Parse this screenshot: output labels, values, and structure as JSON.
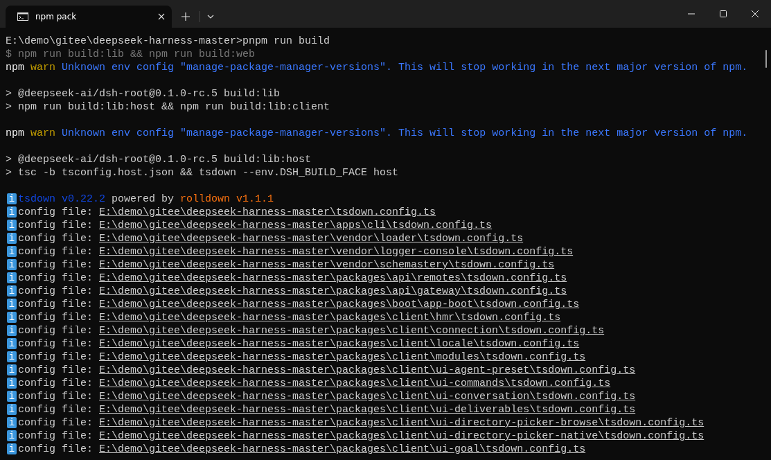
{
  "window": {
    "tab": {
      "title": "npm pack",
      "selected": true
    }
  },
  "lines": [
    {
      "kind": "text",
      "segments": [
        {
          "text": "E:\\demo\\gitee\\deepseek-harness-master>pnpm run build",
          "kind": "plain"
        }
      ]
    },
    {
      "kind": "text",
      "segments": [
        {
          "text": "$ npm run build:lib && npm run build:web",
          "kind": "dim"
        }
      ]
    },
    {
      "kind": "text",
      "segments": [
        {
          "text": "npm",
          "kind": "bright"
        },
        {
          "text": " warn",
          "kind": "warn"
        },
        {
          "text": " Unknown env config \"manage-package-manager-versions\". This will stop working in the next major version of npm.",
          "kind": "blue"
        }
      ]
    },
    {
      "kind": "blank"
    },
    {
      "kind": "text",
      "segments": [
        {
          "text": "> @deepseek-ai/dsh-root@0.1.0-rc.5 build:lib",
          "kind": "plain"
        }
      ]
    },
    {
      "kind": "text",
      "segments": [
        {
          "text": "> npm run build:lib:host && npm run build:lib:client",
          "kind": "plain"
        }
      ]
    },
    {
      "kind": "blank"
    },
    {
      "kind": "text",
      "segments": [
        {
          "text": "npm",
          "kind": "bright"
        },
        {
          "text": " warn",
          "kind": "warn"
        },
        {
          "text": " Unknown env config \"manage-package-manager-versions\". This will stop working in the next major version of npm.",
          "kind": "blue"
        }
      ]
    },
    {
      "kind": "blank"
    },
    {
      "kind": "text",
      "segments": [
        {
          "text": "> @deepseek-ai/dsh-root@0.1.0-rc.5 build:lib:host",
          "kind": "plain"
        }
      ]
    },
    {
      "kind": "text",
      "segments": [
        {
          "text": "> tsc -b tsconfig.host.json && tsdown --env.DSH_BUILD_FACE host",
          "kind": "plain"
        }
      ]
    },
    {
      "kind": "blank"
    },
    {
      "kind": "text",
      "segments": [
        {
          "text": "i",
          "kind": "badge"
        },
        {
          "text": "tsdown v0.22.2",
          "kind": "darkblue"
        },
        {
          "text": " powered by ",
          "kind": "plain"
        },
        {
          "text": "rolldown v1.1.1",
          "kind": "orange"
        }
      ]
    },
    {
      "kind": "text",
      "segments": [
        {
          "text": "i",
          "kind": "badge"
        },
        {
          "text": "config file: ",
          "kind": "plain"
        },
        {
          "text": "E:\\demo\\gitee\\deepseek-harness-master\\tsdown.config.ts",
          "kind": "link"
        }
      ]
    },
    {
      "kind": "text",
      "segments": [
        {
          "text": "i",
          "kind": "badge"
        },
        {
          "text": "config file: ",
          "kind": "plain"
        },
        {
          "text": "E:\\demo\\gitee\\deepseek-harness-master\\apps\\cli\\tsdown.config.ts",
          "kind": "link"
        }
      ]
    },
    {
      "kind": "text",
      "segments": [
        {
          "text": "i",
          "kind": "badge"
        },
        {
          "text": "config file: ",
          "kind": "plain"
        },
        {
          "text": "E:\\demo\\gitee\\deepseek-harness-master\\vendor\\loader\\tsdown.config.ts",
          "kind": "link"
        }
      ]
    },
    {
      "kind": "text",
      "segments": [
        {
          "text": "i",
          "kind": "badge"
        },
        {
          "text": "config file: ",
          "kind": "plain"
        },
        {
          "text": "E:\\demo\\gitee\\deepseek-harness-master\\vendor\\logger-console\\tsdown.config.ts",
          "kind": "link"
        }
      ]
    },
    {
      "kind": "text",
      "segments": [
        {
          "text": "i",
          "kind": "badge"
        },
        {
          "text": "config file: ",
          "kind": "plain"
        },
        {
          "text": "E:\\demo\\gitee\\deepseek-harness-master\\vendor\\schemastery\\tsdown.config.ts",
          "kind": "link"
        }
      ]
    },
    {
      "kind": "text",
      "segments": [
        {
          "text": "i",
          "kind": "badge"
        },
        {
          "text": "config file: ",
          "kind": "plain"
        },
        {
          "text": "E:\\demo\\gitee\\deepseek-harness-master\\packages\\api\\remotes\\tsdown.config.ts",
          "kind": "link"
        }
      ]
    },
    {
      "kind": "text",
      "segments": [
        {
          "text": "i",
          "kind": "badge"
        },
        {
          "text": "config file: ",
          "kind": "plain"
        },
        {
          "text": "E:\\demo\\gitee\\deepseek-harness-master\\packages\\api\\gateway\\tsdown.config.ts",
          "kind": "link"
        }
      ]
    },
    {
      "kind": "text",
      "segments": [
        {
          "text": "i",
          "kind": "badge"
        },
        {
          "text": "config file: ",
          "kind": "plain"
        },
        {
          "text": "E:\\demo\\gitee\\deepseek-harness-master\\packages\\boot\\app-boot\\tsdown.config.ts",
          "kind": "link"
        }
      ]
    },
    {
      "kind": "text",
      "segments": [
        {
          "text": "i",
          "kind": "badge"
        },
        {
          "text": "config file: ",
          "kind": "plain"
        },
        {
          "text": "E:\\demo\\gitee\\deepseek-harness-master\\packages\\client\\hmr\\tsdown.config.ts",
          "kind": "link"
        }
      ]
    },
    {
      "kind": "text",
      "segments": [
        {
          "text": "i",
          "kind": "badge"
        },
        {
          "text": "config file: ",
          "kind": "plain"
        },
        {
          "text": "E:\\demo\\gitee\\deepseek-harness-master\\packages\\client\\connection\\tsdown.config.ts",
          "kind": "link"
        }
      ]
    },
    {
      "kind": "text",
      "segments": [
        {
          "text": "i",
          "kind": "badge"
        },
        {
          "text": "config file: ",
          "kind": "plain"
        },
        {
          "text": "E:\\demo\\gitee\\deepseek-harness-master\\packages\\client\\locale\\tsdown.config.ts",
          "kind": "link"
        }
      ]
    },
    {
      "kind": "text",
      "segments": [
        {
          "text": "i",
          "kind": "badge"
        },
        {
          "text": "config file: ",
          "kind": "plain"
        },
        {
          "text": "E:\\demo\\gitee\\deepseek-harness-master\\packages\\client\\modules\\tsdown.config.ts",
          "kind": "link"
        }
      ]
    },
    {
      "kind": "text",
      "segments": [
        {
          "text": "i",
          "kind": "badge"
        },
        {
          "text": "config file: ",
          "kind": "plain"
        },
        {
          "text": "E:\\demo\\gitee\\deepseek-harness-master\\packages\\client\\ui-agent-preset\\tsdown.config.ts",
          "kind": "link"
        }
      ]
    },
    {
      "kind": "text",
      "segments": [
        {
          "text": "i",
          "kind": "badge"
        },
        {
          "text": "config file: ",
          "kind": "plain"
        },
        {
          "text": "E:\\demo\\gitee\\deepseek-harness-master\\packages\\client\\ui-commands\\tsdown.config.ts",
          "kind": "link"
        }
      ]
    },
    {
      "kind": "text",
      "segments": [
        {
          "text": "i",
          "kind": "badge"
        },
        {
          "text": "config file: ",
          "kind": "plain"
        },
        {
          "text": "E:\\demo\\gitee\\deepseek-harness-master\\packages\\client\\ui-conversation\\tsdown.config.ts",
          "kind": "link"
        }
      ]
    },
    {
      "kind": "text",
      "segments": [
        {
          "text": "i",
          "kind": "badge"
        },
        {
          "text": "config file: ",
          "kind": "plain"
        },
        {
          "text": "E:\\demo\\gitee\\deepseek-harness-master\\packages\\client\\ui-deliverables\\tsdown.config.ts",
          "kind": "link"
        }
      ]
    },
    {
      "kind": "text",
      "segments": [
        {
          "text": "i",
          "kind": "badge"
        },
        {
          "text": "config file: ",
          "kind": "plain"
        },
        {
          "text": "E:\\demo\\gitee\\deepseek-harness-master\\packages\\client\\ui-directory-picker-browse\\tsdown.config.ts",
          "kind": "link"
        }
      ]
    },
    {
      "kind": "text",
      "segments": [
        {
          "text": "i",
          "kind": "badge"
        },
        {
          "text": "config file: ",
          "kind": "plain"
        },
        {
          "text": "E:\\demo\\gitee\\deepseek-harness-master\\packages\\client\\ui-directory-picker-native\\tsdown.config.ts",
          "kind": "link"
        }
      ]
    },
    {
      "kind": "text",
      "segments": [
        {
          "text": "i",
          "kind": "badge"
        },
        {
          "text": "config file: ",
          "kind": "plain"
        },
        {
          "text": "E:\\demo\\gitee\\deepseek-harness-master\\packages\\client\\ui-goal\\tsdown.config.ts",
          "kind": "link"
        }
      ]
    }
  ]
}
